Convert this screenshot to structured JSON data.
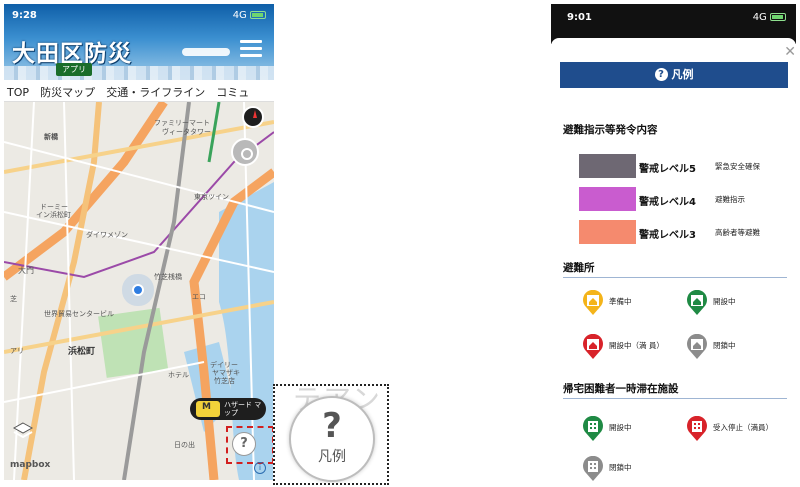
{
  "left_screen": {
    "status_time": "9:28",
    "status_signal": "4G",
    "banner_title": "大田区防災",
    "banner_badge": "アプリ",
    "tabs": [
      {
        "label": "TOP"
      },
      {
        "label": "防災マップ"
      },
      {
        "label": "交通・ライフライン"
      },
      {
        "label": "コミュ"
      }
    ],
    "map_labels": [
      "ファミリーマート",
      "ヴィータタワー",
      "新橋",
      "ドーミー",
      "イン浜松町",
      "世界貿易センタービル",
      "浜松町",
      "ダイワメゾン",
      "大門",
      "芝",
      "竹芝桟橋",
      "アリ",
      "ホテル",
      "東京ツイン",
      "エコ",
      "デイリー",
      "ヤマザキ",
      "竹芝店",
      "日の出"
    ],
    "hazard_button_label": "ハザード マップ",
    "legend_button_glyph": "?",
    "mapbox_logo": "mapbox",
    "accent_color": "#2b6cb0"
  },
  "zoom_inset": {
    "faded_text": "テアン",
    "glyph": "?",
    "label": "凡例"
  },
  "right_screen": {
    "status_time": "9:01",
    "status_signal": "4G",
    "header_title": "凡例",
    "header_color": "#1f4d8d",
    "sections": {
      "evacuation_orders": "避難指示等発令内容",
      "shelters": "避難所",
      "stranded_facilities": "帰宅困難者一時滞在施設"
    },
    "levels": [
      {
        "name": "警戒レベル5",
        "desc": "緊急安全確保",
        "color": "#6e6873"
      },
      {
        "name": "警戒レベル4",
        "desc": "避難指示",
        "color": "#c95ccf"
      },
      {
        "name": "警戒レベル3",
        "desc": "高齢者等避難",
        "color": "#f58a6e"
      }
    ],
    "shelter_items": [
      {
        "label": "準備中",
        "color": "#f4b41a",
        "icon": "shelter-house-icon"
      },
      {
        "label": "開設中",
        "color": "#1f8a44",
        "icon": "shelter-house-icon"
      },
      {
        "label": "開設中（満 員）",
        "color": "#d8232a",
        "icon": "shelter-house-icon"
      },
      {
        "label": "閉鎖中",
        "color": "#8c8c8c",
        "icon": "shelter-house-icon"
      }
    ],
    "facility_items": [
      {
        "label": "開設中",
        "color": "#1f8a44",
        "icon": "building-icon"
      },
      {
        "label": "受入停止（満員）",
        "color": "#d8232a",
        "icon": "building-icon"
      },
      {
        "label": "閉鎖中",
        "color": "#8c8c8c",
        "icon": "building-icon"
      }
    ]
  }
}
